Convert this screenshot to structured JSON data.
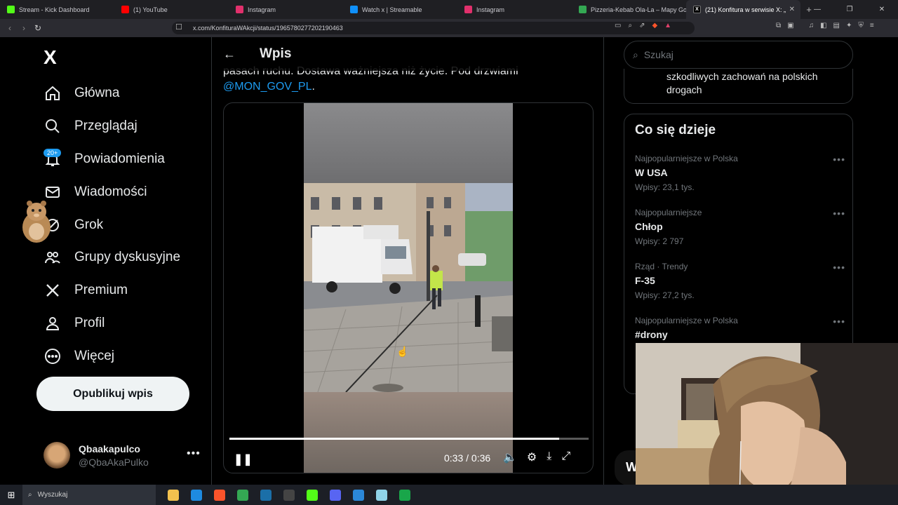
{
  "browser": {
    "tabs": [
      {
        "title": "Stream - Kick Dashboard",
        "icon": "kick-icon",
        "color": "#53fc18"
      },
      {
        "title": "(1) YouTube",
        "icon": "youtube-icon",
        "color": "#ff0000"
      },
      {
        "title": "Instagram",
        "icon": "instagram-icon",
        "color": "#e1306c"
      },
      {
        "title": "Watch x | Streamable",
        "icon": "streamable-icon",
        "color": "#0f90fa"
      },
      {
        "title": "Instagram",
        "icon": "instagram-icon",
        "color": "#e1306c"
      },
      {
        "title": "Pizzeria-Kebab Ola-La – Mapy Googl",
        "icon": "maps-pin-icon",
        "color": "#34a853"
      },
      {
        "title": "(21) Konfitura w serwisie X: „",
        "icon": "x-icon",
        "color": "#000000"
      }
    ],
    "url": "x.com/KonfituraWAkcji/status/1965780277202190463"
  },
  "sidebar": {
    "logo": "X",
    "items": [
      {
        "label": "Główna",
        "icon": "home-icon"
      },
      {
        "label": "Przeglądaj",
        "icon": "search-icon"
      },
      {
        "label": "Powiadomienia",
        "icon": "bell-icon",
        "badge": "20+"
      },
      {
        "label": "Wiadomości",
        "icon": "mail-icon"
      },
      {
        "label": "Grok",
        "icon": "grok-icon"
      },
      {
        "label": "Grupy dyskusyjne",
        "icon": "communities-icon"
      },
      {
        "label": "Premium",
        "icon": "x-icon"
      },
      {
        "label": "Profil",
        "icon": "profile-icon"
      },
      {
        "label": "Więcej",
        "icon": "more-circle-icon"
      }
    ],
    "publish_label": "Opublikuj wpis",
    "account": {
      "name": "Qbaakapulco",
      "handle": "@QbaAkaPulko"
    }
  },
  "main": {
    "title": "Wpis",
    "tweet_text_partial": "pasach ruchu. Dostawa ważniejsza niż życie. Pod drzwiami",
    "mention": "@MON_GOV_PL",
    "mention_suffix": ".",
    "video": {
      "time": "0:33 / 0:36",
      "progress": 0.917
    }
  },
  "right": {
    "search_placeholder": "Szukaj",
    "prev_card_text": "szkodliwych zachowań na polskich drogach",
    "trends_title": "Co się dzieje",
    "trends": [
      {
        "context": "Najpopularniejsze w Polska",
        "name": "W USA",
        "count": "Wpisy: 23,1 tys."
      },
      {
        "context": "Najpopularniejsze",
        "name": "Chłop",
        "count": "Wpisy: 2 797"
      },
      {
        "context": "Rząd · Trendy",
        "name": "F-35",
        "count": "Wpisy: 27,2 tys."
      },
      {
        "context": "Najpopularniejsze w Polska",
        "name": "#drony",
        "count": ""
      }
    ]
  },
  "taskbar": {
    "search_label": "Wyszukaj",
    "apps": [
      {
        "icon": "file-explorer-icon",
        "color": "#f2c14e"
      },
      {
        "icon": "edge-icon",
        "color": "#1e8be0"
      },
      {
        "icon": "brave-icon",
        "color": "#fb542b"
      },
      {
        "icon": "chrome-icon",
        "color": "#34a853"
      },
      {
        "icon": "steam-icon",
        "color": "#1b6fa8"
      },
      {
        "icon": "obs-icon",
        "color": "#444444"
      },
      {
        "icon": "kick-icon",
        "color": "#53fc18"
      },
      {
        "icon": "discord-icon",
        "color": "#5865f2"
      },
      {
        "icon": "mail-app-icon",
        "color": "#2b88d8"
      },
      {
        "icon": "notepad-icon",
        "color": "#8fd3e8"
      },
      {
        "icon": "xbox-icon",
        "color": "#19a64a"
      }
    ]
  }
}
